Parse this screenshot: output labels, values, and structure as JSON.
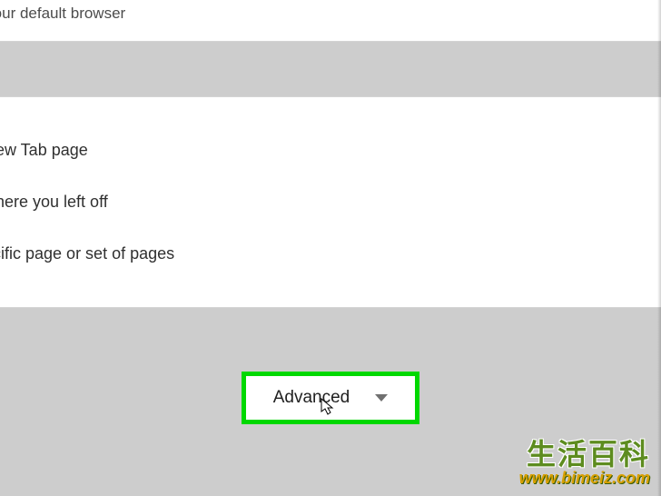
{
  "top_section": {
    "partial_text": "e your default browser"
  },
  "startup_options": {
    "opt1": "New Tab page",
    "opt2": "where you left off",
    "opt3": "ecific page or set of pages"
  },
  "advanced": {
    "label": "Advanced"
  },
  "watermark": {
    "line1": "生活百科",
    "line2": "www.bimeiz.com"
  }
}
